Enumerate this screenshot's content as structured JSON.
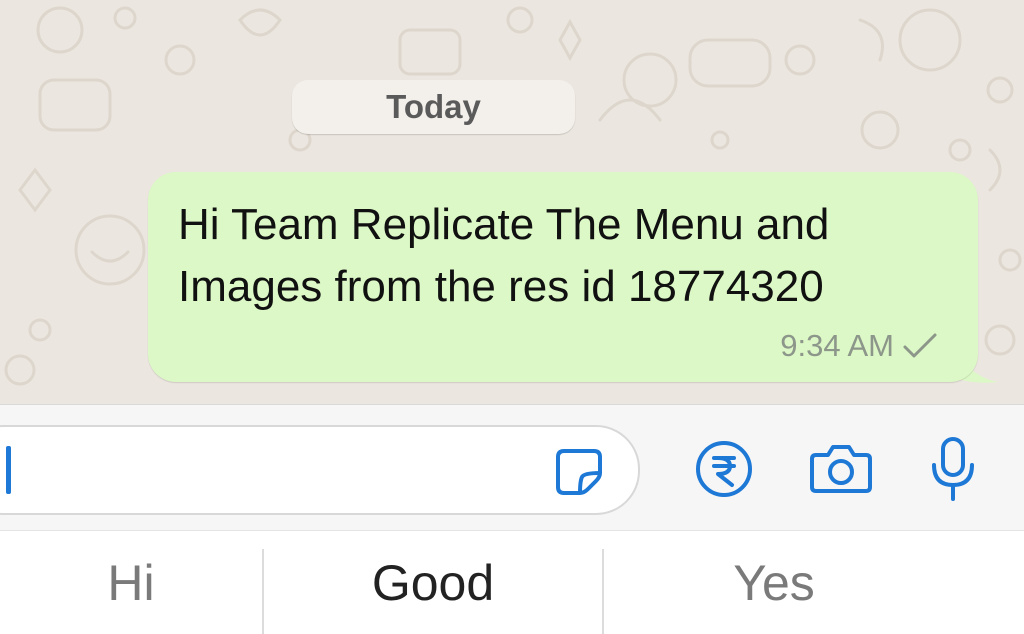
{
  "chat": {
    "date_label": "Today",
    "message": {
      "text": "Hi Team Replicate The Menu and Images from the res id 18774320",
      "time": "9:34 AM",
      "status_icon": "single-check-icon",
      "bubble_color": "#dcf8c6"
    }
  },
  "input_bar": {
    "value": "",
    "icons": [
      "sticker-icon",
      "rupee-payment-icon",
      "camera-icon",
      "microphone-icon"
    ],
    "accent_color": "#1d78d6"
  },
  "suggestions": {
    "items": [
      "Hi",
      "Good",
      "Yes"
    ]
  }
}
